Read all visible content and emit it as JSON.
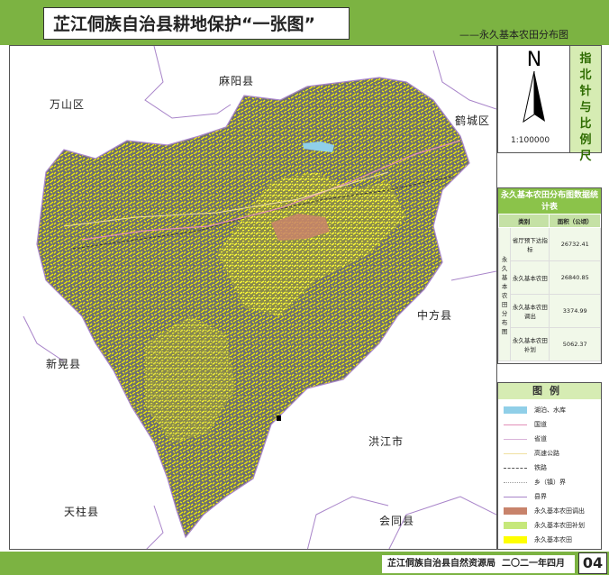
{
  "header": {
    "title": "芷江侗族自治县耕地保护“一张图”",
    "subtitle": "——永久基本农田分布图"
  },
  "map": {
    "place_names": [
      "麻阳县",
      "万山区",
      "鹤城区",
      "中方县",
      "新晃县",
      "洪江市",
      "天柱县",
      "会同县"
    ]
  },
  "compass": {
    "north_label": "N",
    "side_text": [
      "指",
      "北",
      "针",
      "与",
      "比",
      "例",
      "尺"
    ],
    "scale": "1:100000"
  },
  "stats": {
    "title": "永久基本农田分布图数据统计表",
    "col_headers": [
      "类别",
      "面积（公顷）"
    ],
    "group_label": "永久基本农田分布图",
    "rows": [
      {
        "label": "省厅预下达指标",
        "value": "26732.41"
      },
      {
        "label": "永久基本农田",
        "value": "26840.85"
      },
      {
        "label": "永久基本农田调出",
        "value": "3374.99"
      },
      {
        "label": "永久基本农田补划",
        "value": "5062.37"
      }
    ]
  },
  "legend": {
    "title": "图例",
    "items": [
      {
        "label": "湖泊、水库",
        "kind": "fill",
        "color": "#90cfe8"
      },
      {
        "label": "国道",
        "kind": "line",
        "color": "#e28fb8"
      },
      {
        "label": "省道",
        "kind": "line",
        "color": "#d9b3d9"
      },
      {
        "label": "高速公路",
        "kind": "line",
        "color": "#f0e0a0"
      },
      {
        "label": "铁路",
        "kind": "dash",
        "color": "#555555"
      },
      {
        "label": "乡（镇）界",
        "kind": "dot",
        "color": "#9e9e9e"
      },
      {
        "label": "县界",
        "kind": "line",
        "color": "#a884c9"
      },
      {
        "label": "永久基本农田调出",
        "kind": "fill",
        "color": "#c8836b"
      },
      {
        "label": "永久基本农田补划",
        "kind": "fill",
        "color": "#c6e87a"
      },
      {
        "label": "永久基本农田",
        "kind": "fill",
        "color": "#ffff00"
      }
    ]
  },
  "footer": {
    "org": "芷江侗族自治县自然资源局",
    "date": "二〇二一年四月",
    "page": "04"
  },
  "colors": {
    "header_green": "#7cb342",
    "county_fill": "#6d6e70",
    "farmland": "#ffff00"
  }
}
